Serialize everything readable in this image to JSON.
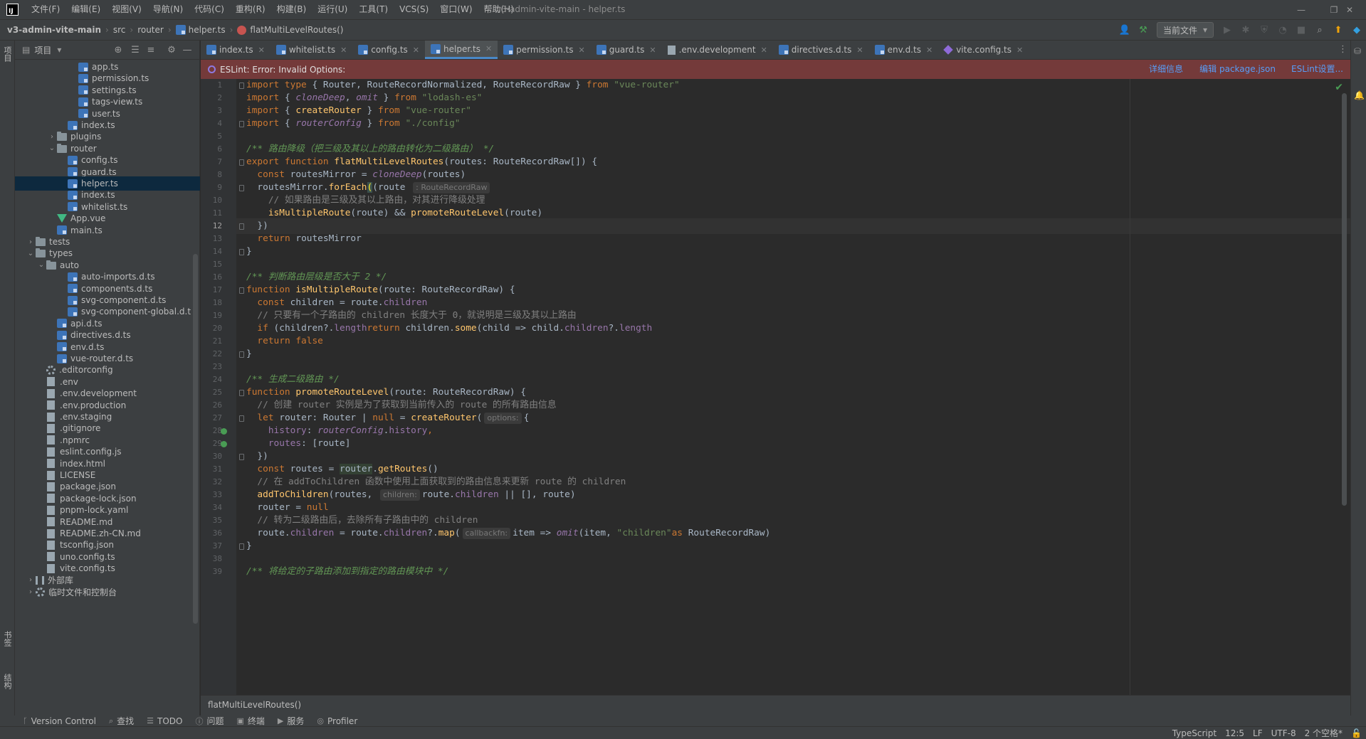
{
  "titlebar": {
    "logo": "IJ",
    "menus": [
      "文件(F)",
      "编辑(E)",
      "视图(V)",
      "导航(N)",
      "代码(C)",
      "重构(R)",
      "构建(B)",
      "运行(U)",
      "工具(T)",
      "VCS(S)",
      "窗口(W)",
      "帮助(H)"
    ],
    "window_title": "v3-admin-vite-main - helper.ts"
  },
  "navbar": {
    "crumbs": [
      "v3-admin-vite-main",
      "src",
      "router",
      "helper.ts",
      "flatMultiLevelRoutes()"
    ],
    "run_config": "当前文件"
  },
  "left_strip": {
    "top_label": "项目",
    "bottom_labels": [
      "书签",
      "结构"
    ]
  },
  "project_panel": {
    "title": "项目",
    "tree": [
      {
        "name": "app.ts",
        "icon": "ts",
        "depth": 5
      },
      {
        "name": "permission.ts",
        "icon": "ts",
        "depth": 5
      },
      {
        "name": "settings.ts",
        "icon": "ts",
        "depth": 5
      },
      {
        "name": "tags-view.ts",
        "icon": "ts",
        "depth": 5
      },
      {
        "name": "user.ts",
        "icon": "ts",
        "depth": 5
      },
      {
        "name": "index.ts",
        "icon": "ts",
        "depth": 4
      },
      {
        "name": "plugins",
        "icon": "folder",
        "depth": 3,
        "arrow": "›"
      },
      {
        "name": "router",
        "icon": "folder",
        "depth": 3,
        "arrow": "⌄"
      },
      {
        "name": "config.ts",
        "icon": "ts",
        "depth": 4
      },
      {
        "name": "guard.ts",
        "icon": "ts",
        "depth": 4
      },
      {
        "name": "helper.ts",
        "icon": "ts",
        "depth": 4,
        "selected": true
      },
      {
        "name": "index.ts",
        "icon": "ts",
        "depth": 4
      },
      {
        "name": "whitelist.ts",
        "icon": "ts",
        "depth": 4
      },
      {
        "name": "App.vue",
        "icon": "vue",
        "depth": 3
      },
      {
        "name": "main.ts",
        "icon": "ts",
        "depth": 3
      },
      {
        "name": "tests",
        "icon": "folder",
        "depth": 1,
        "arrow": "›"
      },
      {
        "name": "types",
        "icon": "folder",
        "depth": 1,
        "arrow": "⌄"
      },
      {
        "name": "auto",
        "icon": "folder",
        "depth": 2,
        "arrow": "⌄"
      },
      {
        "name": "auto-imports.d.ts",
        "icon": "ts",
        "depth": 4
      },
      {
        "name": "components.d.ts",
        "icon": "ts",
        "depth": 4
      },
      {
        "name": "svg-component.d.ts",
        "icon": "ts",
        "depth": 4
      },
      {
        "name": "svg-component-global.d.t",
        "icon": "ts",
        "depth": 4
      },
      {
        "name": "api.d.ts",
        "icon": "ts",
        "depth": 3
      },
      {
        "name": "directives.d.ts",
        "icon": "ts",
        "depth": 3
      },
      {
        "name": "env.d.ts",
        "icon": "ts",
        "depth": 3
      },
      {
        "name": "vue-router.d.ts",
        "icon": "ts",
        "depth": 3
      },
      {
        "name": ".editorconfig",
        "icon": "gear",
        "depth": 2
      },
      {
        "name": ".env",
        "icon": "file",
        "depth": 2
      },
      {
        "name": ".env.development",
        "icon": "file",
        "depth": 2
      },
      {
        "name": ".env.production",
        "icon": "file",
        "depth": 2
      },
      {
        "name": ".env.staging",
        "icon": "file",
        "depth": 2
      },
      {
        "name": ".gitignore",
        "icon": "file",
        "depth": 2
      },
      {
        "name": ".npmrc",
        "icon": "file",
        "depth": 2
      },
      {
        "name": "eslint.config.js",
        "icon": "file",
        "depth": 2
      },
      {
        "name": "index.html",
        "icon": "file",
        "depth": 2
      },
      {
        "name": "LICENSE",
        "icon": "file",
        "depth": 2
      },
      {
        "name": "package.json",
        "icon": "file",
        "depth": 2
      },
      {
        "name": "package-lock.json",
        "icon": "file",
        "depth": 2
      },
      {
        "name": "pnpm-lock.yaml",
        "icon": "file",
        "depth": 2
      },
      {
        "name": "README.md",
        "icon": "file",
        "depth": 2
      },
      {
        "name": "README.zh-CN.md",
        "icon": "file",
        "depth": 2
      },
      {
        "name": "tsconfig.json",
        "icon": "file",
        "depth": 2
      },
      {
        "name": "uno.config.ts",
        "icon": "file",
        "depth": 2
      },
      {
        "name": "vite.config.ts",
        "icon": "file",
        "depth": 2
      },
      {
        "name": "外部库",
        "icon": "lib",
        "depth": 1,
        "arrow": "›"
      },
      {
        "name": "临时文件和控制台",
        "icon": "gear",
        "depth": 1,
        "arrow": "›"
      }
    ]
  },
  "tabs": [
    {
      "label": "index.ts",
      "icon": "ts"
    },
    {
      "label": "whitelist.ts",
      "icon": "ts"
    },
    {
      "label": "config.ts",
      "icon": "ts"
    },
    {
      "label": "helper.ts",
      "icon": "ts",
      "active": true
    },
    {
      "label": "permission.ts",
      "icon": "ts"
    },
    {
      "label": "guard.ts",
      "icon": "ts"
    },
    {
      "label": ".env.development",
      "icon": "env"
    },
    {
      "label": "directives.d.ts",
      "icon": "ts"
    },
    {
      "label": "env.d.ts",
      "icon": "ts"
    },
    {
      "label": "vite.config.ts",
      "icon": "vite"
    }
  ],
  "banner": {
    "message": "ESLint: Error: Invalid Options:",
    "links": [
      "详细信息",
      "编辑 package.json",
      "ESLint设置..."
    ]
  },
  "editor": {
    "current_line": 12,
    "lines": [
      [
        [
          "kw",
          "import type "
        ],
        [
          "",
          "{ Router, RouteRecordNormalized, RouteRecordRaw } "
        ],
        [
          "kw",
          "from "
        ],
        [
          "str",
          "\"vue-router\""
        ]
      ],
      [
        [
          "kw",
          "import "
        ],
        [
          "",
          "{ "
        ],
        [
          "it",
          "cloneDeep"
        ],
        [
          "",
          ", "
        ],
        [
          "it",
          "omit"
        ],
        [
          "",
          " } "
        ],
        [
          "kw",
          "from "
        ],
        [
          "str",
          "\"lodash-es\""
        ]
      ],
      [
        [
          "kw",
          "import "
        ],
        [
          "",
          "{ "
        ],
        [
          "fn",
          "createRouter"
        ],
        [
          "",
          " } "
        ],
        [
          "kw",
          "from "
        ],
        [
          "str",
          "\"vue-router\""
        ]
      ],
      [
        [
          "kw",
          "import "
        ],
        [
          "",
          "{ "
        ],
        [
          "it",
          "routerConfig"
        ],
        [
          "",
          " } "
        ],
        [
          "kw",
          "from "
        ],
        [
          "str",
          "\"./config\""
        ]
      ],
      [],
      [
        [
          "doc",
          "/** 路由降级（把三级及其以上的路由转化为二级路由） */"
        ]
      ],
      [
        [
          "kw",
          "export function "
        ],
        [
          "fn",
          "flatMultiLevelRoutes"
        ],
        [
          "",
          "(routes: RouteRecordRaw[]) {"
        ]
      ],
      [
        [
          "",
          "  "
        ],
        [
          "kw",
          "const "
        ],
        [
          "",
          "routesMirror = "
        ],
        [
          "it",
          "cloneDeep"
        ],
        [
          "",
          "(routes)"
        ]
      ],
      [
        [
          "",
          "  routesMirror."
        ],
        [
          "fn",
          "forEach"
        ],
        [
          "brace",
          "("
        ],
        [
          "",
          "(route "
        ],
        [
          "hint",
          ": RouteRecordRaw"
        ],
        [
          ") => {"
        ]
      ],
      [
        [
          "cm",
          "    // 如果路由是三级及其以上路由，对其进行降级处理"
        ]
      ],
      [
        [
          "",
          "    "
        ],
        [
          "fn",
          "isMultipleRoute"
        ],
        [
          "",
          "(route) && "
        ],
        [
          "fn",
          "promoteRouteLevel"
        ],
        [
          "",
          "(route)"
        ]
      ],
      [
        [
          "",
          "  })"
        ]
      ],
      [
        [
          "",
          "  "
        ],
        [
          "kw",
          "return "
        ],
        [
          "",
          "routesMirror"
        ]
      ],
      [
        [
          "",
          "}"
        ]
      ],
      [],
      [
        [
          "doc",
          "/** 判断路由层级是否大于 2 */"
        ]
      ],
      [
        [
          "kw",
          "function "
        ],
        [
          "fn",
          "isMultipleRoute"
        ],
        [
          "",
          "(route: RouteRecordRaw) {"
        ]
      ],
      [
        [
          "",
          "  "
        ],
        [
          "kw",
          "const "
        ],
        [
          "",
          "children = route."
        ],
        [
          "pr",
          "children"
        ]
      ],
      [
        [
          "cm",
          "  // 只要有一个子路由的 children 长度大于 0，就说明是三级及其以上路由"
        ]
      ],
      [
        [
          "",
          "  "
        ],
        [
          "kw",
          "if "
        ],
        [
          "",
          "(children?."
        ],
        [
          "pr",
          "length"
        ],
        [
          ") "
        ],
        [
          "kw",
          "return "
        ],
        [
          "",
          "children."
        ],
        [
          "fn",
          "some"
        ],
        [
          "",
          "(child => child."
        ],
        [
          "pr",
          "children"
        ],
        [
          "",
          "?."
        ],
        [
          "pr",
          "length"
        ],
        [
          ")"
        ]
      ],
      [
        [
          "",
          "  "
        ],
        [
          "kw",
          "return false"
        ]
      ],
      [
        [
          "",
          "}"
        ]
      ],
      [],
      [
        [
          "doc",
          "/** 生成二级路由 */"
        ]
      ],
      [
        [
          "kw",
          "function "
        ],
        [
          "fn",
          "promoteRouteLevel"
        ],
        [
          "",
          "(route: RouteRecordRaw) {"
        ]
      ],
      [
        [
          "cm",
          "  // 创建 router 实例是为了获取到当前传入的 route 的所有路由信息"
        ]
      ],
      [
        [
          "",
          "  "
        ],
        [
          "kw",
          "let "
        ],
        [
          "",
          "router: Router | "
        ],
        [
          "kw",
          "null "
        ],
        [
          "",
          "= "
        ],
        [
          "fn",
          "createRouter"
        ],
        [
          "",
          "("
        ],
        [
          "hint",
          "options:"
        ],
        [
          "",
          "{"
        ]
      ],
      [
        [
          "",
          "    "
        ],
        [
          "pr",
          "history"
        ],
        [
          "",
          ": "
        ],
        [
          "it",
          "routerConfig"
        ],
        [
          "",
          "."
        ],
        [
          "pr",
          "history"
        ],
        [
          "kw",
          ","
        ]
      ],
      [
        [
          "",
          "    "
        ],
        [
          "pr",
          "routes"
        ],
        [
          "",
          ": [route]"
        ]
      ],
      [
        [
          "",
          "  })"
        ]
      ],
      [
        [
          "",
          "  "
        ],
        [
          "kw",
          "const "
        ],
        [
          "",
          "routes = "
        ],
        [
          "hlw",
          "router"
        ],
        [
          "",
          "."
        ],
        [
          "fn",
          "getRoutes"
        ],
        [
          "",
          "()"
        ]
      ],
      [
        [
          "cm",
          "  // 在 addToChildren 函数中使用上面获取到的路由信息来更新 route 的 children"
        ]
      ],
      [
        [
          "",
          "  "
        ],
        [
          "fn",
          "addToChildren"
        ],
        [
          "",
          "(routes, "
        ],
        [
          "hint",
          "children:"
        ],
        [
          "",
          "route."
        ],
        [
          "pr",
          "children"
        ],
        [
          "",
          " || [], route)"
        ]
      ],
      [
        [
          "",
          "  router = "
        ],
        [
          "kw",
          "null"
        ]
      ],
      [
        [
          "cm",
          "  // 转为二级路由后，去除所有子路由中的 children"
        ]
      ],
      [
        [
          "",
          "  route."
        ],
        [
          "pr",
          "children"
        ],
        [
          "",
          " = route."
        ],
        [
          "pr",
          "children"
        ],
        [
          "",
          "?."
        ],
        [
          "fn",
          "map"
        ],
        [
          "",
          "("
        ],
        [
          "hint",
          "callbackfn:"
        ],
        [
          "",
          "item => "
        ],
        [
          "it",
          "omit"
        ],
        [
          "",
          "(item, "
        ],
        [
          "str",
          "\"children\""
        ],
        [
          ") "
        ],
        [
          "kw",
          "as "
        ],
        [
          "",
          "RouteRecordRaw)"
        ]
      ],
      [
        [
          "",
          "}"
        ]
      ],
      [],
      [
        [
          "doc",
          "/** 将给定的子路由添加到指定的路由模块中 */"
        ]
      ]
    ]
  },
  "editor_breadcrumb": "flatMultiLevelRoutes()",
  "bottom_tools": [
    {
      "label": "Version Control",
      "icon": "branch-icon",
      "glyph": "ᚴ"
    },
    {
      "label": "查找",
      "icon": "search-icon",
      "glyph": "⌕"
    },
    {
      "label": "TODO",
      "icon": "todo-icon",
      "glyph": "☰"
    },
    {
      "label": "问题",
      "icon": "problems-icon",
      "glyph": "ⓘ"
    },
    {
      "label": "终端",
      "icon": "terminal-icon",
      "glyph": "▣"
    },
    {
      "label": "服务",
      "icon": "services-icon",
      "glyph": "▶"
    },
    {
      "label": "Profiler",
      "icon": "profiler-icon",
      "glyph": "◎"
    }
  ],
  "status": {
    "language": "TypeScript",
    "position": "12:5",
    "line_sep": "LF",
    "encoding": "UTF-8",
    "indent": "2 个空格*"
  }
}
